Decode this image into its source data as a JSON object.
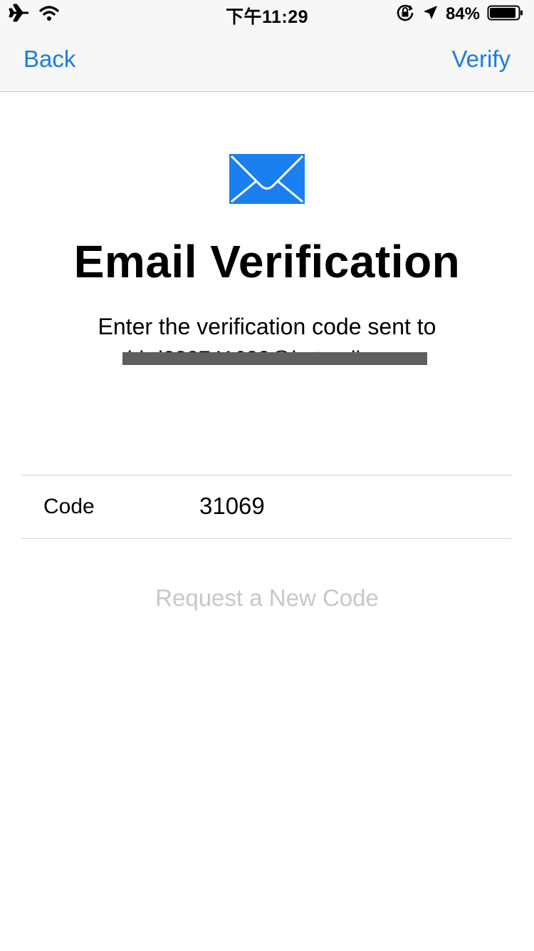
{
  "status_bar": {
    "time": "下午11:29",
    "battery_percent": "84%",
    "icons": [
      "airplane-icon",
      "wifi-icon",
      "orientation-lock-icon",
      "location-arrow-icon",
      "battery-icon"
    ]
  },
  "nav": {
    "back_label": "Back",
    "verify_label": "Verify",
    "accent_color": "#1a7de3"
  },
  "main": {
    "icon": "envelope-icon",
    "icon_color": "#1a7ff0",
    "title": "Email Verification",
    "subtitle": "Enter the verification code sent to",
    "email": "bird283741683@hotmail.com"
  },
  "form": {
    "code_label": "Code",
    "code_value": "31069"
  },
  "request_new_code_label": "Request a New Code"
}
